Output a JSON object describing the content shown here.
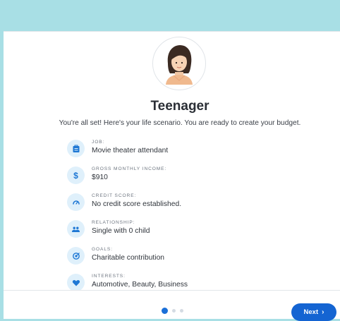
{
  "scenario": {
    "title": "Teenager",
    "subtitle": "You're all set! Here's your life scenario. You are ready to create your budget."
  },
  "avatar": {
    "icon": "teenage-girl-avatar-icon"
  },
  "details": [
    {
      "icon": "briefcase-icon",
      "label": "JOB:",
      "value": "Movie theater attendant"
    },
    {
      "icon": "dollar-icon",
      "label": "GROSS MONTHLY INCOME:",
      "value": "$910"
    },
    {
      "icon": "gauge-icon",
      "label": "CREDIT SCORE:",
      "value": "No credit score established."
    },
    {
      "icon": "people-icon",
      "label": "RELATIONSHIP:",
      "value": "Single with 0 child"
    },
    {
      "icon": "target-icon",
      "label": "GOALS:",
      "value": "Charitable contribution"
    },
    {
      "icon": "heart-icon",
      "label": "INTERESTS:",
      "value": "Automotive, Beauty, Business"
    }
  ],
  "pagination": {
    "total": 3,
    "current": 1
  },
  "next_button": {
    "label": "Next",
    "chevron": "›"
  },
  "colors": {
    "background": "#a8dfe5",
    "accent": "#1464d2",
    "icon_bg": "#dff0fb"
  }
}
